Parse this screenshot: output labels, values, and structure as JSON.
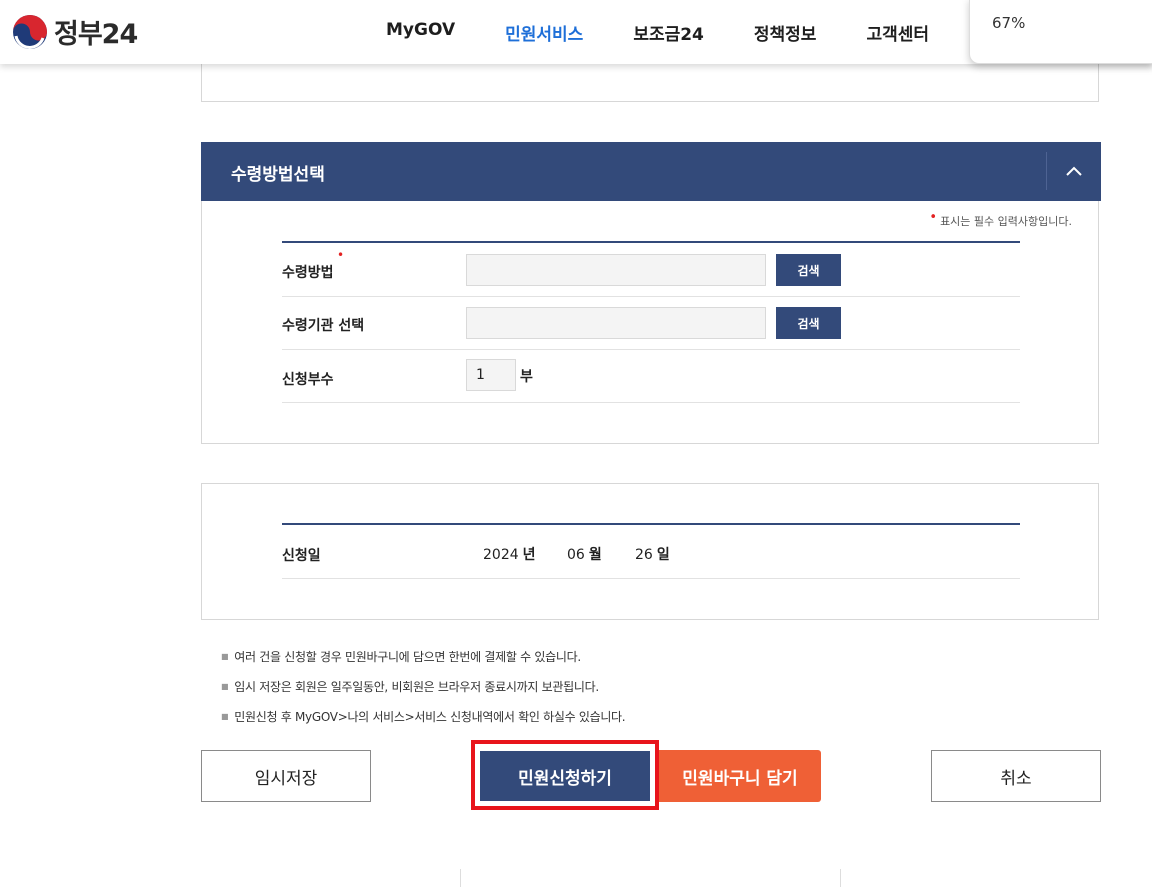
{
  "header": {
    "logo_text": "정부24",
    "nav": [
      "MyGOV",
      "민원서비스",
      "보조금24",
      "정책정보",
      "고객센터"
    ],
    "active_nav": "민원서비스"
  },
  "zoom": {
    "label": "67%"
  },
  "receive_section": {
    "title": "수령방법선택",
    "required_note": "표시는 필수 입력사항입니다.",
    "rows": {
      "method_label": "수령방법",
      "method_value": "",
      "agency_label": "수령기관 선택",
      "agency_value": "",
      "copies_label": "신청부수",
      "copies_value": "1",
      "copies_unit": "부"
    },
    "search_button": "검색"
  },
  "date_section": {
    "label": "신청일",
    "year": "2024",
    "year_unit": "년",
    "month": "06",
    "month_unit": "월",
    "day": "26",
    "day_unit": "일"
  },
  "notices": [
    "여러 건을 신청할 경우 민원바구니에 담으면 한번에 결제할 수 있습니다.",
    "임시 저장은 회원은 일주일동안, 비회원은 브라우저 종료시까지 보관됩니다.",
    "민원신청 후 MyGOV>나의 서비스>서비스 신청내역에서 확인 하실수 있습니다."
  ],
  "buttons": {
    "temp_save": "임시저장",
    "apply": "민원신청하기",
    "add_basket": "민원바구니 담기",
    "cancel": "취소"
  },
  "colors": {
    "primary_navy": "#334a7a",
    "accent_orange": "#ef6036",
    "nav_active": "#1e6fd8",
    "highlight_red": "#e8141b",
    "required_red": "#e32222"
  }
}
